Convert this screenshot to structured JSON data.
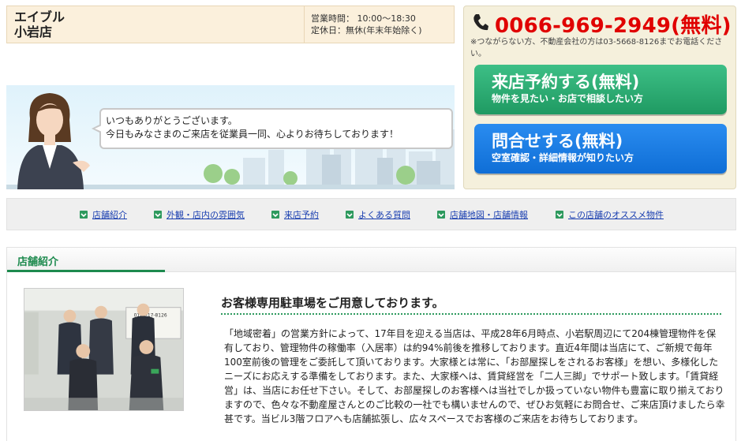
{
  "store": {
    "name_line1": "エイブル",
    "name_line2": "小岩店",
    "hours": "営業時間： 10:00～18:30",
    "closed": "定休日：無休(年末年始除く)"
  },
  "hero": {
    "greeting_line1": "いつもありがとうございます。",
    "greeting_line2": "今日もみなさまのご来店を従業員一同、心よりお待ちしております！"
  },
  "contact": {
    "phone": "0066-969-2949(無料)",
    "note": "※つながらない方、不動産会社の方は03-5668-8126までお電話ください。",
    "visit_title": "来店予約する(無料)",
    "visit_sub": "物件を見たい・お店で相談したい方",
    "inquiry_title": "問合せする(無料)",
    "inquiry_sub": "空室確認・詳細情報が知りたい方"
  },
  "nav": {
    "items": [
      {
        "label": "店舗紹介"
      },
      {
        "label": "外観・店内の雰囲気"
      },
      {
        "label": "来店予約"
      },
      {
        "label": "よくある質問"
      },
      {
        "label": "店舗地図・店舗情報"
      },
      {
        "label": "この店舗のオススメ物件"
      }
    ]
  },
  "intro": {
    "section_title": "店舗紹介",
    "headline": "お客様専用駐車場をご用意しております。",
    "body": "「地域密着」の営業方針によって、17年目を迎える当店は、平成28年6月時点、小岩駅周辺にて204棟管理物件を保有しており、管理物件の稼働率（入居率）は約94%前後を推移しております。直近4年間は当店にて、ご新規で毎年100室前後の管理をご委託して頂いております。大家様とは常に、「お部屋探しをされるお客様」を想い、多様化したニーズにお応えする準備をしております。また、大家様へは、賃貸経営を「二人三脚」でサポート致します。「賃貸経営」は、当店にお任せ下さい。そして、お部屋探しのお客様へは当社でしか扱っていない物件も豊富に取り揃えておりますので、色々な不動産屋さんとのご比較の一社でも構いませんので、ぜひお気軽にお問合せ、ご来店頂けましたら幸甚です。当ビル3階フロアへも店舗拡張し、広々スペースでお客様のご来店をお待ちしております。",
    "photo_sign": "0120-17-8126"
  },
  "colors": {
    "phone_red": "#e00000",
    "green": "#1d8a4e",
    "button_green": "#2bab72",
    "button_blue": "#1a7ee6",
    "link_blue": "#1a3fb0"
  }
}
